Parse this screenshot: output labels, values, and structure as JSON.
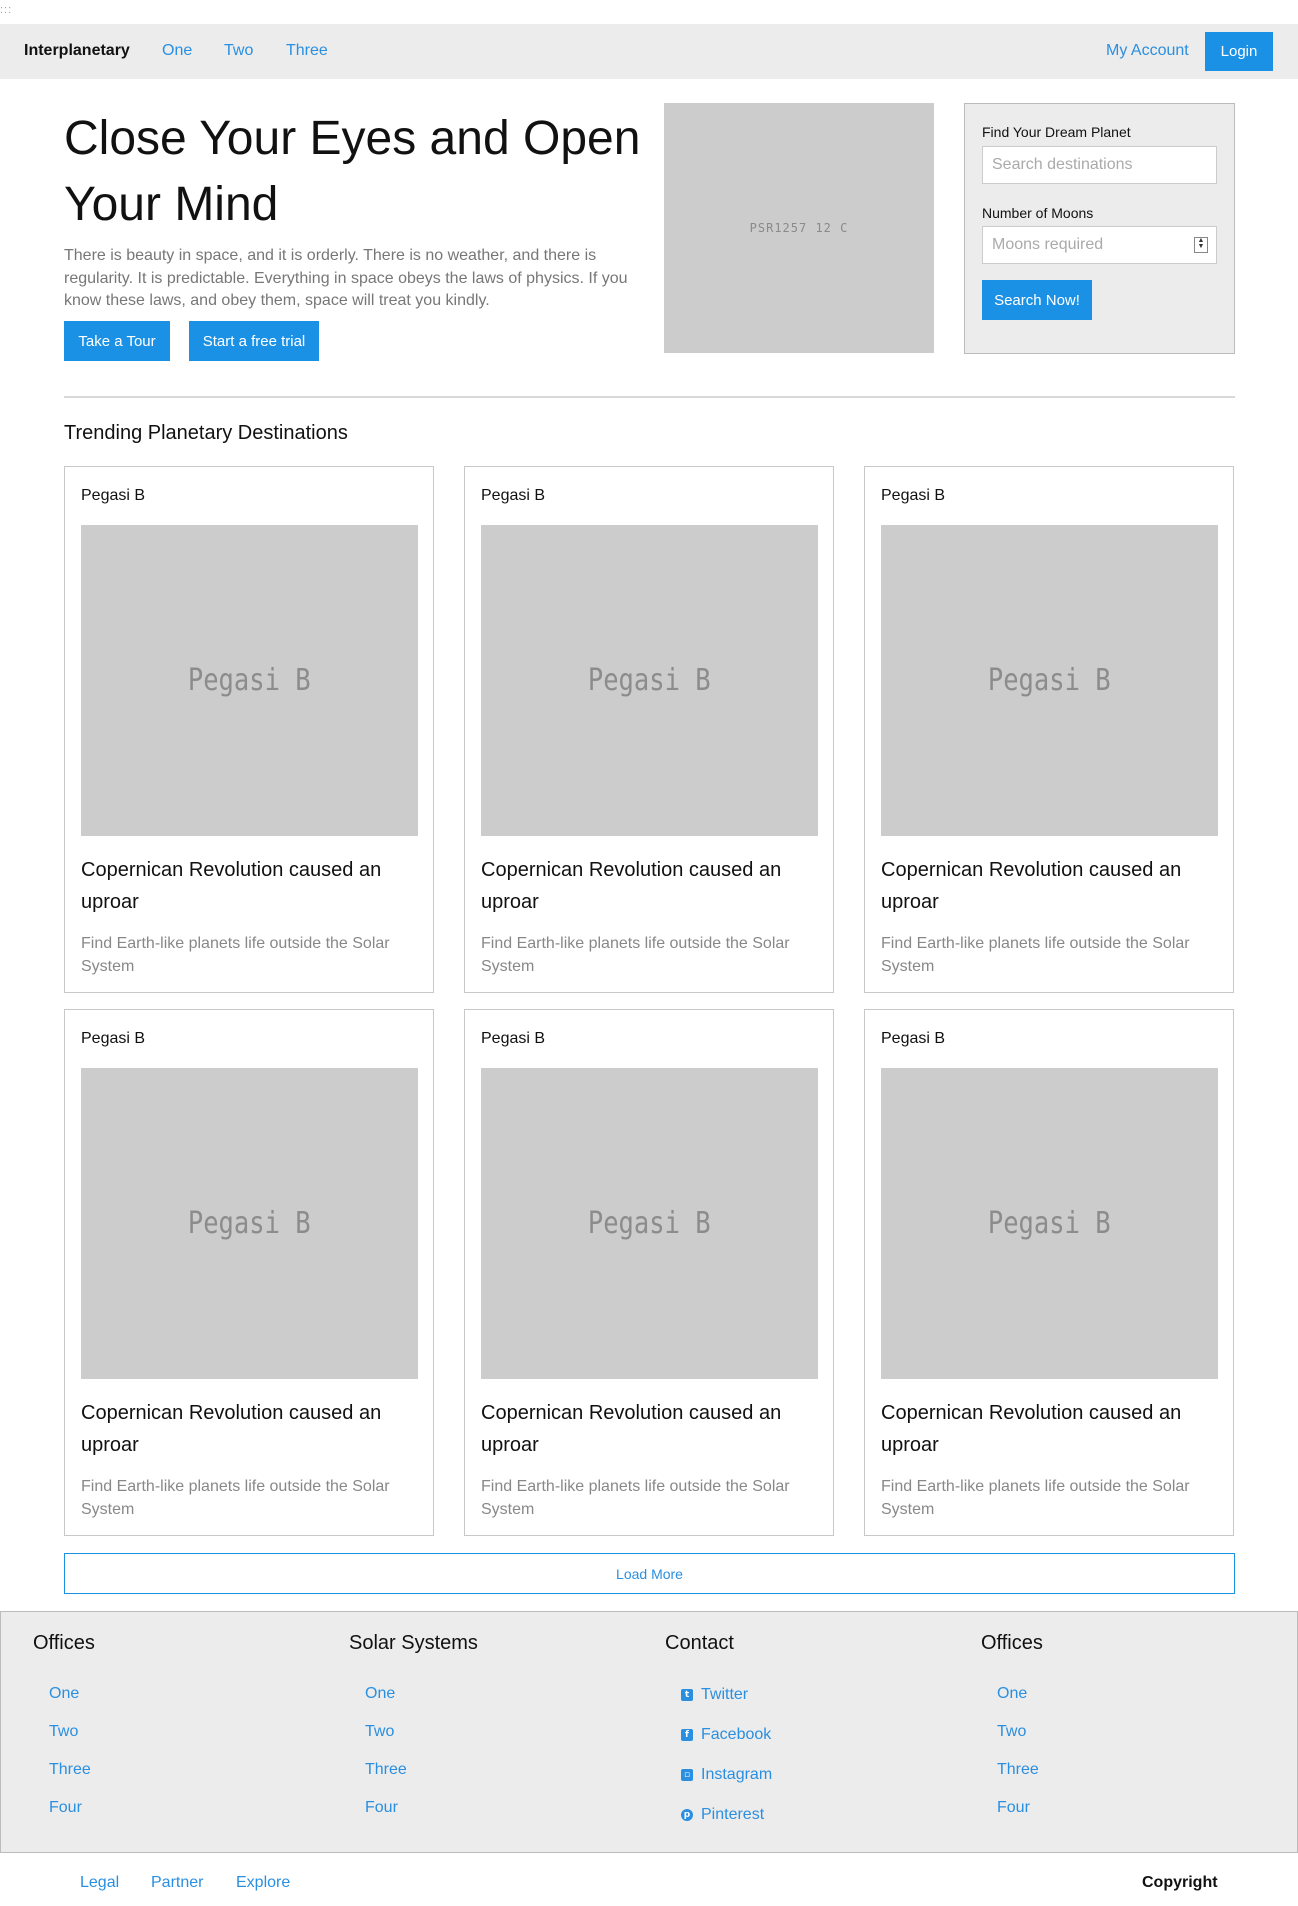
{
  "top_dots": ":::",
  "navbar": {
    "brand": "Interplanetary",
    "links": [
      "One",
      "Two",
      "Three"
    ],
    "account": "My Account",
    "login": "Login"
  },
  "hero": {
    "title": "Close Your Eyes and Open Your Mind",
    "text": "There is beauty in space, and it is orderly. There is no weather, and there is regularity. It is predictable. Everything in space obeys the laws of physics. If you know these laws, and obey them, space will treat you kindly.",
    "tour_button": "Take a Tour",
    "trial_button": "Start a free trial",
    "image_label": "PSR1257   12 C"
  },
  "search": {
    "planet_label": "Find Your Dream Planet",
    "planet_placeholder": "Search destinations",
    "moons_label": "Number of Moons",
    "moons_placeholder": "Moons required",
    "submit": "Search Now!"
  },
  "trending": {
    "title": "Trending Planetary Destinations",
    "cards": [
      {
        "name": "Pegasi B",
        "image_label": "Pegasi B",
        "title": "Copernican Revolution caused an uproar",
        "desc": "Find Earth-like planets life outside the Solar System"
      },
      {
        "name": "Pegasi B",
        "image_label": "Pegasi B",
        "title": "Copernican Revolution caused an uproar",
        "desc": "Find Earth-like planets life outside the Solar System"
      },
      {
        "name": "Pegasi B",
        "image_label": "Pegasi B",
        "title": "Copernican Revolution caused an uproar",
        "desc": "Find Earth-like planets life outside the Solar System"
      },
      {
        "name": "Pegasi B",
        "image_label": "Pegasi B",
        "title": "Copernican Revolution caused an uproar",
        "desc": "Find Earth-like planets life outside the Solar System"
      },
      {
        "name": "Pegasi B",
        "image_label": "Pegasi B",
        "title": "Copernican Revolution caused an uproar",
        "desc": "Find Earth-like planets life outside the Solar System"
      },
      {
        "name": "Pegasi B",
        "image_label": "Pegasi B",
        "title": "Copernican Revolution caused an uproar",
        "desc": "Find Earth-like planets life outside the Solar System"
      }
    ],
    "load_more": "Load More"
  },
  "footer": {
    "columns": [
      {
        "heading": "Offices",
        "links": [
          "One",
          "Two",
          "Three",
          "Four"
        ]
      },
      {
        "heading": "Solar Systems",
        "links": [
          "One",
          "Two",
          "Three",
          "Four"
        ]
      },
      {
        "heading": "Contact",
        "links": [
          "Twitter",
          "Facebook",
          "Instagram",
          "Pinterest"
        ],
        "icons": [
          "twitter-icon",
          "facebook-icon",
          "instagram-icon",
          "pinterest-icon"
        ]
      },
      {
        "heading": "Offices",
        "links": [
          "One",
          "Two",
          "Three",
          "Four"
        ]
      }
    ]
  },
  "bottom": {
    "links": [
      "Legal",
      "Partner",
      "Explore"
    ],
    "copyright": "Copyright"
  },
  "colors": {
    "accent": "#1b91e6",
    "link": "#2a8fe0",
    "placeholder_gray": "#cccccc",
    "panel_gray": "#ececec"
  }
}
